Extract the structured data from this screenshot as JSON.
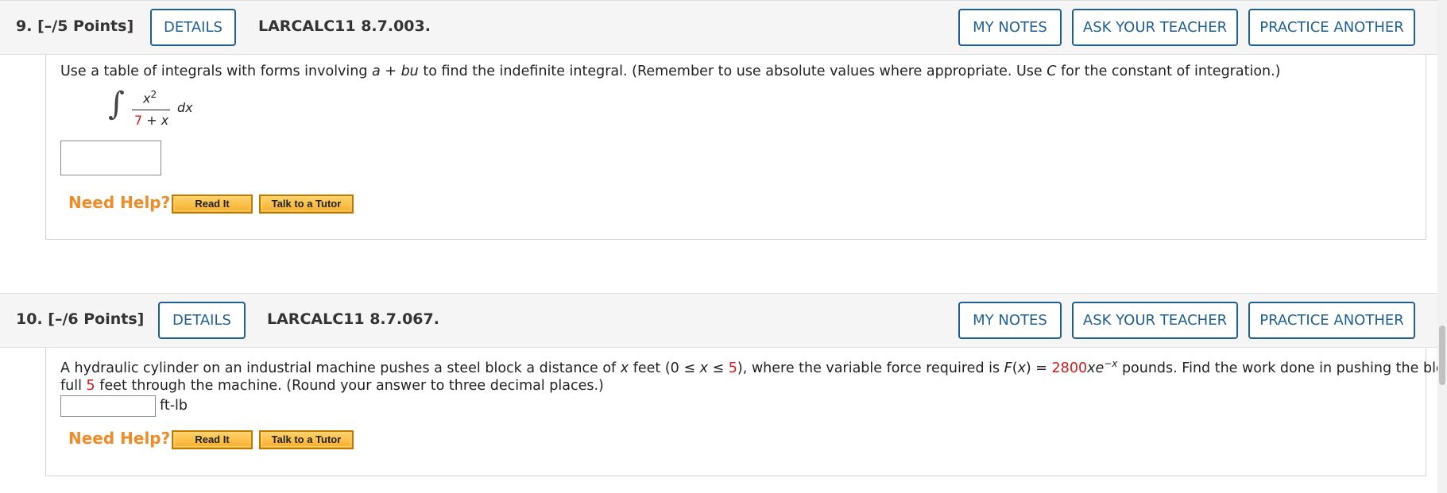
{
  "q9": {
    "number": "9.",
    "points": "[–/5 Points]",
    "details_label": "DETAILS",
    "code": "LARCALC11 8.7.003.",
    "my_notes_label": "MY NOTES",
    "ask_teacher_label": "ASK YOUR TEACHER",
    "practice_label": "PRACTICE ANOTHER",
    "prompt_part1": "Use a table of integrals with forms involving ",
    "prompt_var_a": "a",
    "prompt_plus": " + ",
    "prompt_var_bu": "bu",
    "prompt_part2": " to find the indefinite integral. (Remember to use absolute values where appropriate. Use ",
    "prompt_var_c": "C",
    "prompt_part3": " for the constant of integration.)",
    "integral_sign": "∫",
    "numerator_base": "x",
    "numerator_exp": "2",
    "denominator_const": "7",
    "denominator_rest": " + ",
    "denominator_var": "x",
    "differential": "dx",
    "answer_value": "",
    "need_help": "Need Help?",
    "read_it": "Read It",
    "talk_tutor": "Talk to a Tutor"
  },
  "q10": {
    "number": "10.",
    "points": "[–/6 Points]",
    "details_label": "DETAILS",
    "code": "LARCALC11 8.7.067.",
    "my_notes_label": "MY NOTES",
    "ask_teacher_label": "ASK YOUR TEACHER",
    "practice_label": "PRACTICE ANOTHER",
    "line1_a": "A hydraulic cylinder on an industrial machine pushes a steel block a distance of ",
    "line1_x": "x",
    "line1_b": " feet (0 ≤ ",
    "line1_x2": "x",
    "line1_c": " ≤ ",
    "line1_five": "5",
    "line1_d": "), where the variable force required is ",
    "line1_fx": "F",
    "line1_e": "(",
    "line1_x3": "x",
    "line1_f": ") = ",
    "line1_coef": "2800",
    "line1_xe": "xe",
    "line1_exp": "−x",
    "line1_g": " pounds. Find the work done in pushing the block the",
    "line2_a": "full ",
    "line2_five": "5",
    "line2_b": " feet through the machine. (Round your answer to three decimal places.)",
    "answer_value": "",
    "unit": "ft-lb",
    "need_help": "Need Help?",
    "read_it": "Read It",
    "talk_tutor": "Talk to a Tutor"
  },
  "colors": {
    "accent_blue": "#1e5f95",
    "need_help_orange": "#f08c28",
    "highlight_red": "#d41a1a",
    "header_bg": "#f5f5f5"
  }
}
